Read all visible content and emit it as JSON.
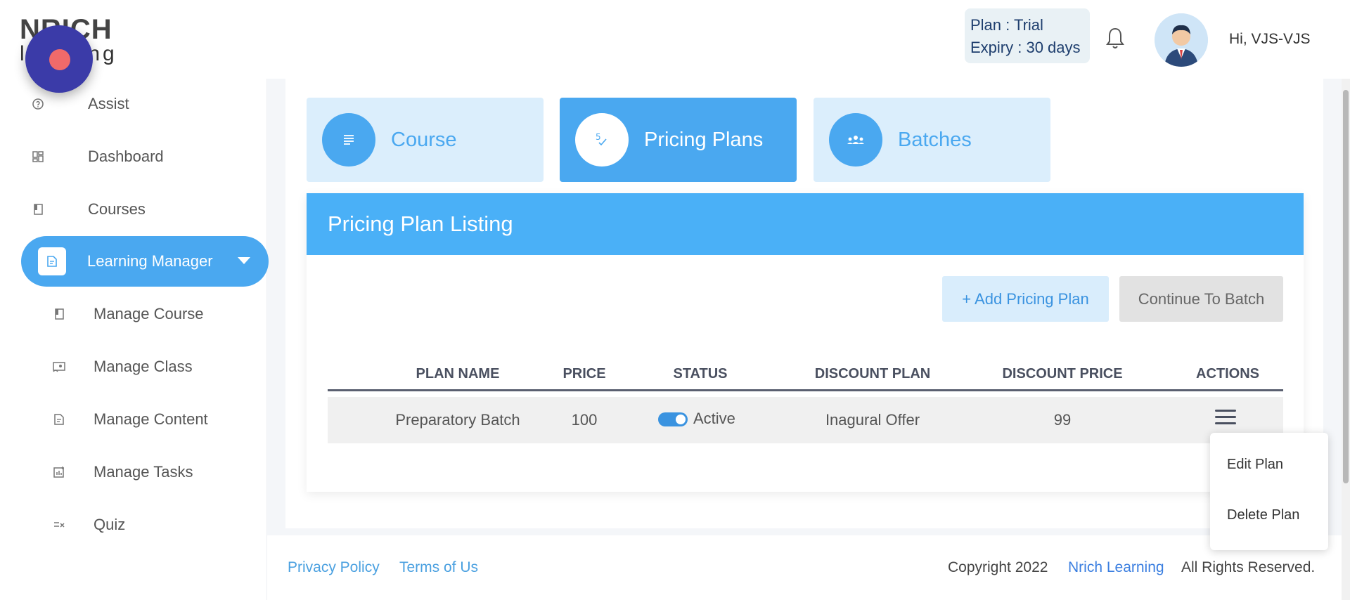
{
  "brand": {
    "logo_top": "NRICH",
    "logo_bottom": "learning"
  },
  "header": {
    "plan_line": "Plan    : Trial",
    "expiry_line": "Expiry : 30 days",
    "greeting": "Hi, VJS-VJS"
  },
  "sidebar": {
    "items": [
      {
        "label": "Assist",
        "icon": "help-icon"
      },
      {
        "label": "Dashboard",
        "icon": "dashboard-icon"
      },
      {
        "label": "Courses",
        "icon": "book-icon"
      },
      {
        "label": "Learning Manager",
        "icon": "document-icon",
        "active": true
      },
      {
        "label": "Manage Course",
        "icon": "book-icon"
      },
      {
        "label": "Manage Class",
        "icon": "class-icon"
      },
      {
        "label": "Manage Content",
        "icon": "content-icon"
      },
      {
        "label": "Manage Tasks",
        "icon": "tasks-icon"
      },
      {
        "label": "Quiz",
        "icon": "quiz-icon"
      }
    ]
  },
  "tabs": [
    {
      "label": "Course",
      "icon": "list-icon"
    },
    {
      "label": "Pricing Plans",
      "icon": "price-icon",
      "active": true
    },
    {
      "label": "Batches",
      "icon": "people-icon"
    }
  ],
  "listing": {
    "title": "Pricing Plan Listing",
    "add_button": "+ Add Pricing Plan",
    "continue_button": "Continue To Batch",
    "columns": [
      "PLAN NAME",
      "PRICE",
      "STATUS",
      "DISCOUNT PLAN",
      "DISCOUNT PRICE",
      "ACTIONS"
    ],
    "rows": [
      {
        "plan_name": "Preparatory Batch",
        "price": "100",
        "status": "Active",
        "discount_plan": "Inagural Offer",
        "discount_price": "99"
      }
    ],
    "actions_menu": [
      "Edit Plan",
      "Delete Plan"
    ]
  },
  "footer": {
    "privacy": "Privacy Policy",
    "terms": "Terms of Us",
    "copyright": "Copyright 2022",
    "brand": "Nrich Learning",
    "rights": "All Rights Reserved."
  },
  "colors": {
    "accent": "#4aa8f0",
    "fab": "#3b3ba8",
    "fab_dot": "#f06a6a"
  }
}
